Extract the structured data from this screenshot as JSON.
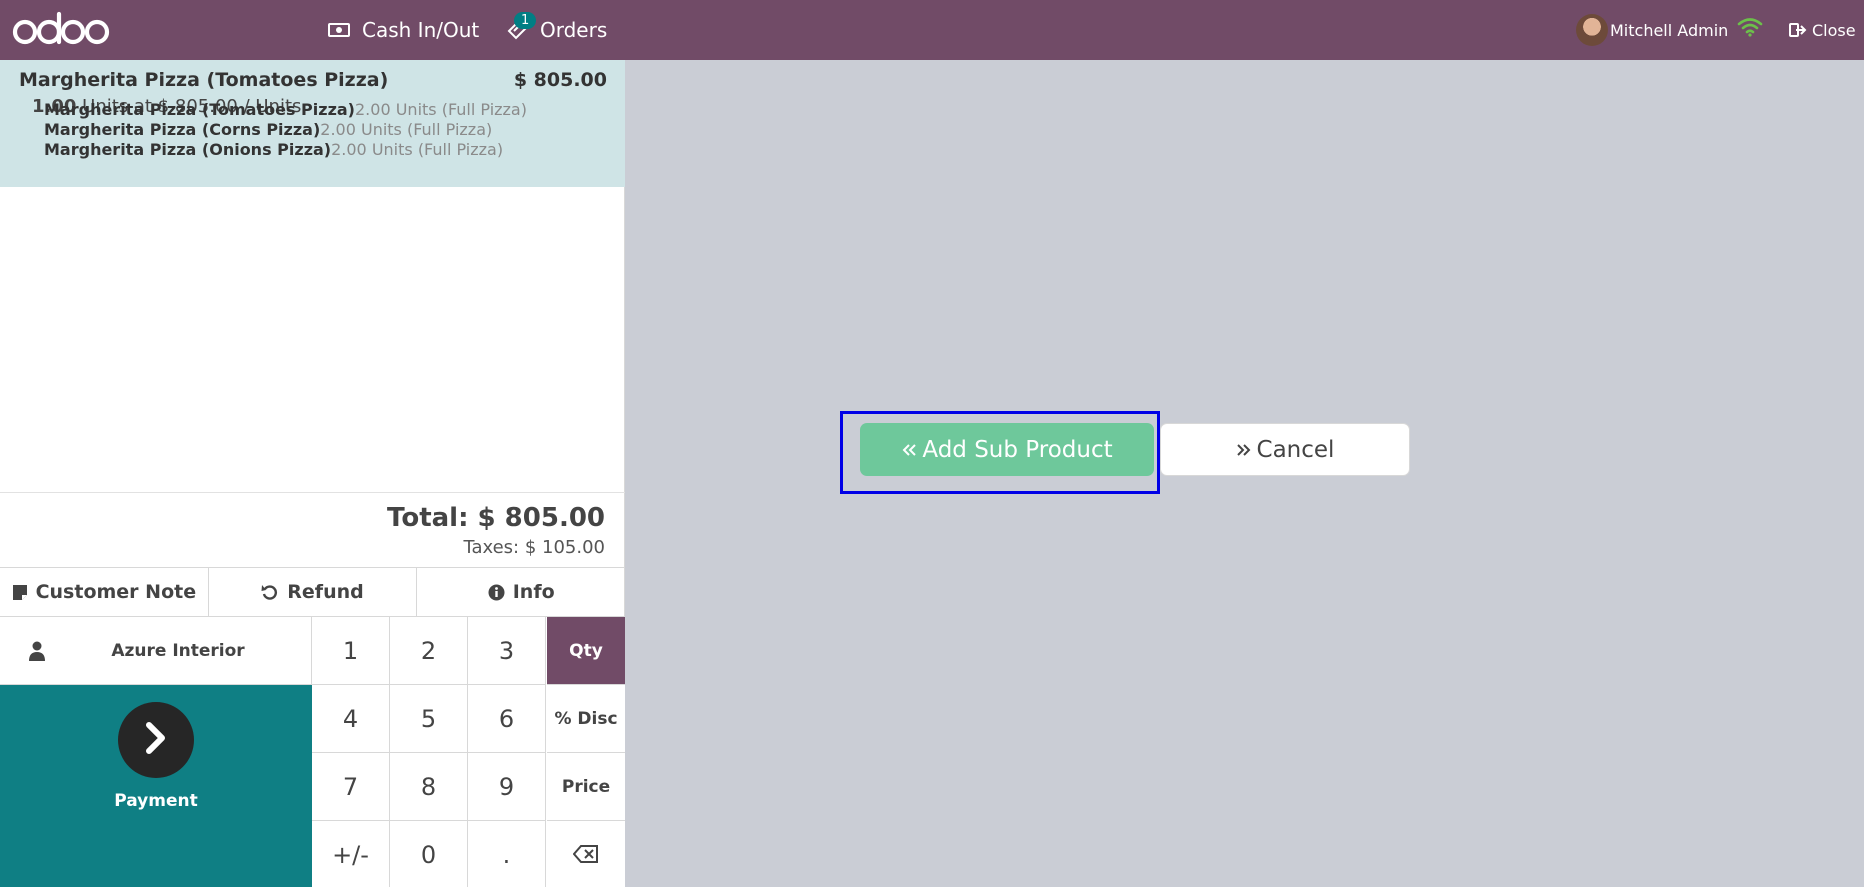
{
  "header": {
    "logo_text": "odoo",
    "cash_in_out": "Cash In/Out",
    "orders": "Orders",
    "orders_count": "1",
    "user_name": "Mitchell Admin",
    "close": "Close",
    "colors": {
      "bar": "#714b67",
      "badge": "#017e84",
      "wifi": "#6cc04a"
    }
  },
  "order": {
    "line": {
      "name": "Margherita Pizza (Tomatoes Pizza)",
      "price": "$ 805.00",
      "qty": "1.00",
      "unit_text": "Units at $ 805.00 / Units",
      "sub_products": [
        {
          "name": "Margherita Pizza (Tomatoes Pizza)",
          "detail": "2.00 Units (Full Pizza)"
        },
        {
          "name": "Margherita Pizza (Corns Pizza)",
          "detail": "2.00 Units (Full Pizza)"
        },
        {
          "name": "Margherita Pizza (Onions Pizza)",
          "detail": "2.00 Units (Full Pizza)"
        }
      ]
    },
    "total": "Total: $ 805.00",
    "taxes": "Taxes: $ 105.00"
  },
  "controls": {
    "customer_note": "Customer Note",
    "refund": "Refund",
    "info": "Info"
  },
  "customer": {
    "name": "Azure Interior"
  },
  "payment": {
    "label": "Payment",
    "color": "#0f7f84"
  },
  "numpad": {
    "keys": [
      "1",
      "2",
      "3",
      "Qty",
      "4",
      "5",
      "6",
      "% Disc",
      "7",
      "8",
      "9",
      "Price",
      "+/-",
      "0",
      ".",
      ""
    ],
    "active_mode": "Qty"
  },
  "dialog": {
    "add_sub_product": "Add Sub Product",
    "cancel": "Cancel",
    "colors": {
      "add": "#6ec89b",
      "focus": "#0000e6"
    }
  }
}
